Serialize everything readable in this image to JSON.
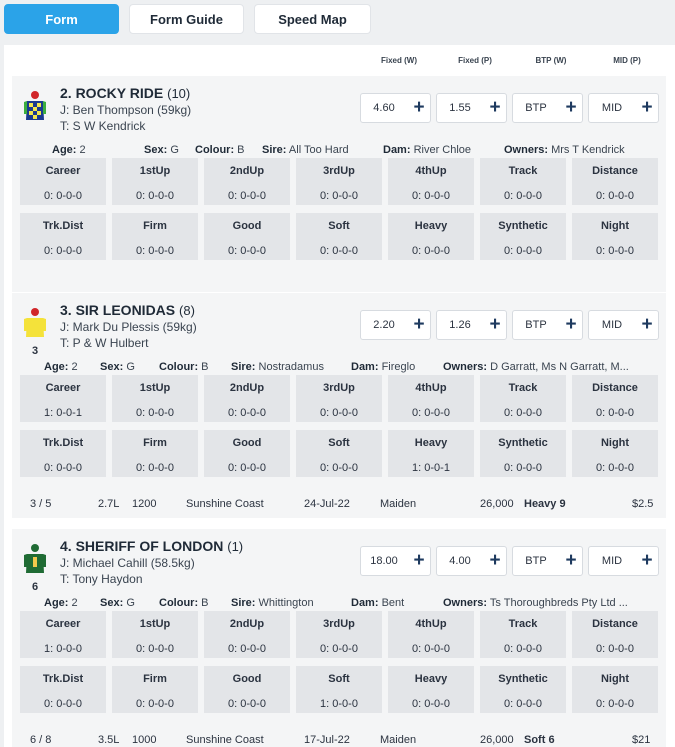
{
  "tabs": [
    "Form",
    "Form Guide",
    "Speed Map"
  ],
  "columns": [
    "Fixed (W)",
    "Fixed (P)",
    "BTP (W)",
    "MID (P)"
  ],
  "colors": {
    "accent": "#2ba3e8",
    "plus": "#1e3a5f"
  },
  "stat_labels": [
    "Career",
    "1stUp",
    "2ndUp",
    "3rdUp",
    "4thUp",
    "Track",
    "Distance",
    "Trk.Dist",
    "Firm",
    "Good",
    "Soft",
    "Heavy",
    "Synthetic",
    "Night"
  ],
  "runners": [
    {
      "name": "2. ROCKY RIDE",
      "barrier": "(10)",
      "silk_number": "",
      "jockey": "J: Ben Thompson (59kg)",
      "trainer": "T: S W Kendrick",
      "odds": [
        "4.60",
        "1.55",
        "BTP",
        "MID"
      ],
      "info": {
        "age": "2",
        "sex": "G",
        "colour": "B",
        "sire": "All Too Hard",
        "dam": "River Chloe",
        "owners": "Mrs T Kendrick"
      },
      "stats": [
        "0: 0-0-0",
        "0: 0-0-0",
        "0: 0-0-0",
        "0: 0-0-0",
        "0: 0-0-0",
        "0: 0-0-0",
        "0: 0-0-0",
        "0: 0-0-0",
        "0: 0-0-0",
        "0: 0-0-0",
        "0: 0-0-0",
        "0: 0-0-0",
        "0: 0-0-0",
        "0: 0-0-0"
      ],
      "last_start": null
    },
    {
      "name": "3. SIR LEONIDAS",
      "barrier": "(8)",
      "silk_number": "3",
      "jockey": "J: Mark Du Plessis (59kg)",
      "trainer": "T: P & W Hulbert",
      "odds": [
        "2.20",
        "1.26",
        "BTP",
        "MID"
      ],
      "info": {
        "age": "2",
        "sex": "G",
        "colour": "B",
        "sire": "Nostradamus",
        "dam": "Fireglo",
        "owners": "D Garratt, Ms N Garratt, M..."
      },
      "stats": [
        "1: 0-0-1",
        "0: 0-0-0",
        "0: 0-0-0",
        "0: 0-0-0",
        "0: 0-0-0",
        "0: 0-0-0",
        "0: 0-0-0",
        "0: 0-0-0",
        "0: 0-0-0",
        "0: 0-0-0",
        "0: 0-0-0",
        "1: 0-0-1",
        "0: 0-0-0",
        "0: 0-0-0"
      ],
      "last_start": {
        "place": "3 / 5",
        "margin": "2.7L",
        "distance": "1200",
        "track": "Sunshine Coast",
        "date": "24-Jul-22",
        "class": "Maiden",
        "prize": "26,000",
        "going": "Heavy 9",
        "price": "$2.5"
      }
    },
    {
      "name": "4. SHERIFF OF LONDON",
      "barrier": "(1)",
      "silk_number": "6",
      "jockey": "J: Michael Cahill (58.5kg)",
      "trainer": "T: Tony Haydon",
      "odds": [
        "18.00",
        "4.00",
        "BTP",
        "MID"
      ],
      "info": {
        "age": "2",
        "sex": "G",
        "colour": "B",
        "sire": "Whittington",
        "dam": "Bent",
        "owners": "Ts Thoroughbreds Pty Ltd ..."
      },
      "stats": [
        "1: 0-0-0",
        "0: 0-0-0",
        "0: 0-0-0",
        "0: 0-0-0",
        "0: 0-0-0",
        "0: 0-0-0",
        "0: 0-0-0",
        "0: 0-0-0",
        "0: 0-0-0",
        "0: 0-0-0",
        "1: 0-0-0",
        "0: 0-0-0",
        "0: 0-0-0",
        "0: 0-0-0"
      ],
      "last_start": {
        "place": "6 / 8",
        "margin": "3.5L",
        "distance": "1000",
        "track": "Sunshine Coast",
        "date": "17-Jul-22",
        "class": "Maiden",
        "prize": "26,000",
        "going": "Soft 6",
        "price": "$21"
      }
    }
  ],
  "labels": {
    "age": "Age:",
    "sex": "Sex:",
    "colour": "Colour:",
    "sire": "Sire:",
    "dam": "Dam:",
    "owners": "Owners:"
  }
}
